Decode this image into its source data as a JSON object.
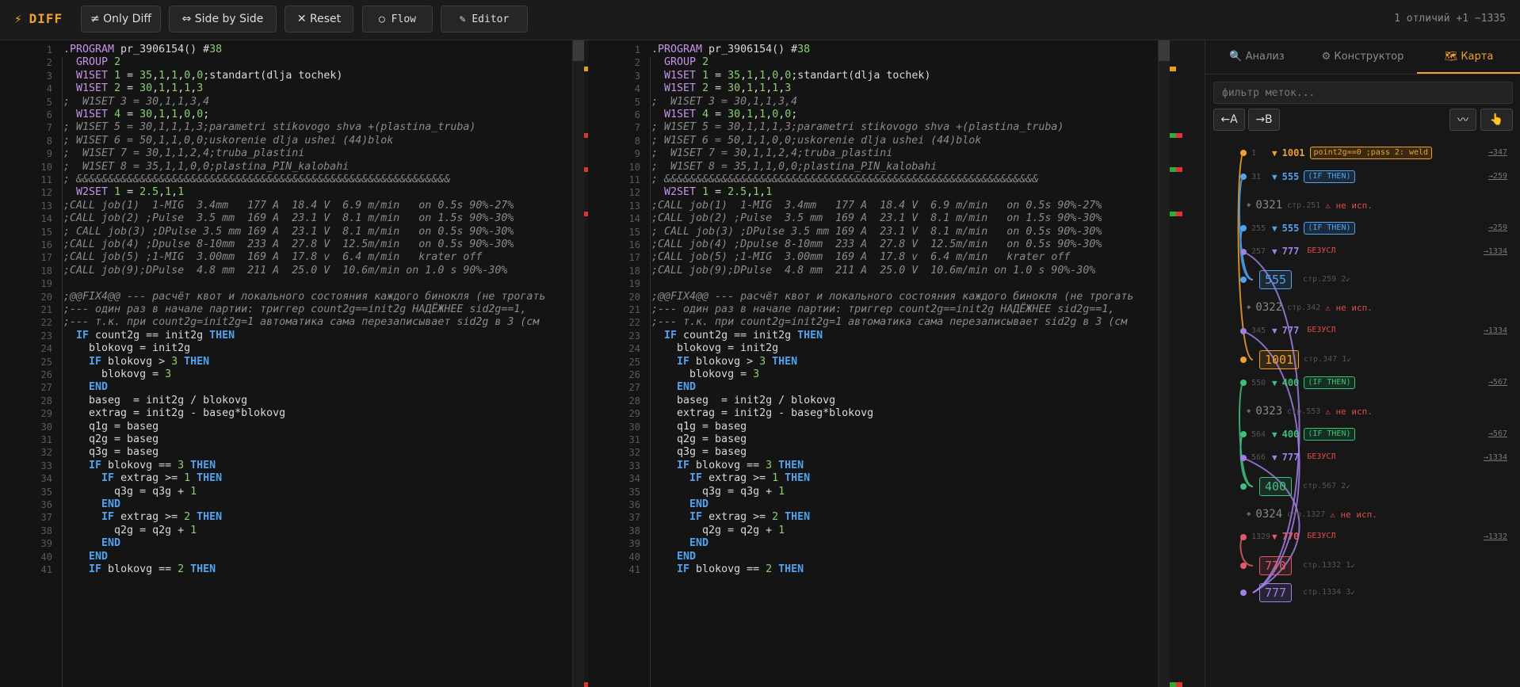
{
  "app": {
    "logo": "DIFF",
    "status": "1 отличий +1 −1335"
  },
  "toolbar": {
    "only_diff": "≠ Only Diff",
    "side_by_side": "⇔ Side by Side",
    "reset": "✕ Reset",
    "flow": "○ Flow",
    "editor": "✎ Editor"
  },
  "code_lines": [
    ".PROGRAM pr_3906154() #38",
    "  GROUP 2",
    "  W1SET 1 = 35,1,1,0,0;standart(dlja tochek)",
    "  W1SET 2 = 30,1,1,1,3",
    ";  W1SET 3 = 30,1,1,3,4",
    "  W1SET 4 = 30,1,1,0,0;",
    "; W1SET 5 = 30,1,1,1,3;parametri stikovogo shva +(plastina_truba)",
    "; W1SET 6 = 50,1,1,0,0;uskorenie dlja ushei (44)blok",
    ";  W1SET 7 = 30,1,1,2,4;truba_plastini",
    ";  W1SET 8 = 35,1,1,0,0;plastina_PIN_kalobahi",
    "; &&&&&&&&&&&&&&&&&&&&&&&&&&&&&&&&&&&&&&&&&&&&&&&&&&&&&&&&&&&",
    "  W2SET 1 = 2.5,1,1",
    ";CALL job(1)  1-MIG  3.4mm   177 A  18.4 V  6.9 m/min   on 0.5s 90%-27%",
    ";CALL job(2) ;Pulse  3.5 mm  169 A  23.1 V  8.1 m/min   on 1.5s 90%-30%",
    "; CALL job(3) ;DPulse 3.5 mm 169 A  23.1 V  8.1 m/min   on 0.5s 90%-30%",
    ";CALL job(4) ;Dpulse 8-10mm  233 A  27.8 V  12.5m/min   on 0.5s 90%-30%",
    ";CALL job(5) ;1-MIG  3.00mm  169 A  17.8 v  6.4 m/min   krater off",
    ";CALL job(9);DPulse  4.8 mm  211 A  25.0 V  10.6m/min on 1.0 s 90%-30%",
    "",
    ";@@FIX4@@ --- расчёт квот и локального состояния каждого бинокля (не трогать",
    ";--- один раз в начале партии: триггер count2g==init2g НАДЁЖНЕЕ sid2g==1,",
    ";--- т.к. при count2g=init2g=1 автоматика сама перезаписывает sid2g в 3 (см",
    "  IF count2g == init2g THEN",
    "    blokovg = init2g",
    "    IF blokovg > 3 THEN",
    "      blokovg = 3",
    "    END",
    "    baseg  = init2g / blokovg",
    "    extrag = init2g - baseg*blokovg",
    "    q1g = baseg",
    "    q2g = baseg",
    "    q3g = baseg",
    "    IF blokovg == 3 THEN",
    "      IF extrag >= 1 THEN",
    "        q3g = q3g + 1",
    "      END",
    "      IF extrag >= 2 THEN",
    "        q2g = q2g + 1",
    "      END",
    "    END",
    "    IF blokovg == 2 THEN"
  ],
  "sidebar": {
    "tabs": [
      "🔍 Анализ",
      "⚙ Конструктор",
      "🗺 Карта"
    ],
    "filter_placeholder": "фильтр меток...",
    "btn_a": "←A",
    "btn_b": "→B",
    "btn_wave": "〰",
    "btn_hand": "👆",
    "rows": [
      {
        "num": "1001",
        "color": "#f0a030",
        "pill": "point2g==0 ;pass 2: weld",
        "link": "→347",
        "lnum": "1"
      },
      {
        "num": "555",
        "color": "#4fa3f0",
        "pill": "(IF THEN)",
        "link": "→259",
        "lnum": "31"
      },
      {
        "num": "555",
        "color": "#4fa3f0",
        "pill": "(IF THEN)",
        "link": "→259",
        "lnum": "255"
      },
      {
        "num": "777",
        "color": "#a17ee8",
        "pill": "БЕЗУСЛ",
        "link": "→1334",
        "lnum": "257"
      },
      {
        "num": "777",
        "color": "#a17ee8",
        "pill": "БЕЗУСЛ",
        "link": "→1334",
        "lnum": "345"
      },
      {
        "num": "400",
        "color": "#3fbf7f",
        "pill": "(IF THEN)",
        "link": "→567",
        "lnum": "550"
      },
      {
        "num": "400",
        "color": "#3fbf7f",
        "pill": "(IF THEN)",
        "link": "→567",
        "lnum": "564"
      },
      {
        "num": "777",
        "color": "#a17ee8",
        "pill": "БЕЗУСЛ",
        "link": "→1334",
        "lnum": "566"
      },
      {
        "num": "770",
        "color": "#e25a6a",
        "pill": "БЕЗУСЛ",
        "link": "→1332",
        "lnum": "1329"
      }
    ],
    "unused": [
      {
        "label": "0321",
        "ref": "стр.251",
        "warn": "⚠ не исп."
      },
      {
        "label": "0322",
        "ref": "стр.342",
        "warn": "⚠ не исп."
      },
      {
        "label": "0323",
        "ref": "стр.553",
        "warn": "⚠ не исп."
      },
      {
        "label": "0324",
        "ref": "стр.1327",
        "warn": "⚠ не исп."
      }
    ],
    "targets": [
      {
        "label": "555",
        "ref": "стр.259",
        "cnt": "2↙",
        "color": "#4fa3f0"
      },
      {
        "label": "1001",
        "ref": "стр.347",
        "cnt": "1↙",
        "color": "#f0a030"
      },
      {
        "label": "400",
        "ref": "стр.567",
        "cnt": "2↙",
        "color": "#3fbf7f"
      },
      {
        "label": "770",
        "ref": "стр.1332",
        "cnt": "1↙",
        "color": "#e25a6a"
      },
      {
        "label": "777",
        "ref": "стр.1334",
        "cnt": "3↙",
        "color": "#a17ee8"
      }
    ]
  }
}
